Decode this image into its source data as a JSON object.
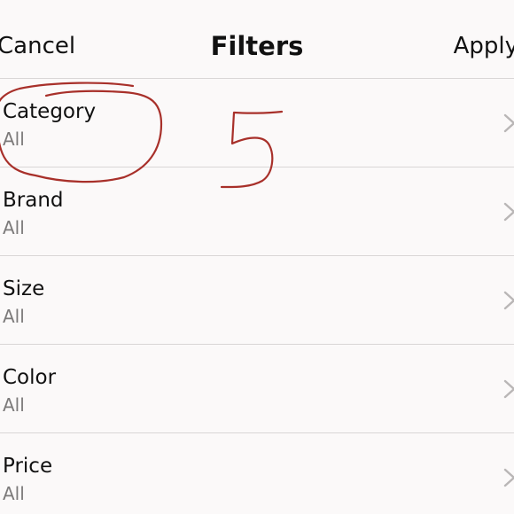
{
  "nav": {
    "cancel_label": "Cancel",
    "title": "Filters",
    "apply_label": "Apply"
  },
  "filters": [
    {
      "label": "Category",
      "value": "All"
    },
    {
      "label": "Brand",
      "value": "All"
    },
    {
      "label": "Size",
      "value": "All"
    },
    {
      "label": "Color",
      "value": "All"
    },
    {
      "label": "Price",
      "value": "All"
    }
  ],
  "annotation": {
    "handwritten_number": "5",
    "ink_color": "#a8302a"
  },
  "icons": {
    "row_chevron": "chevron-right-icon"
  }
}
